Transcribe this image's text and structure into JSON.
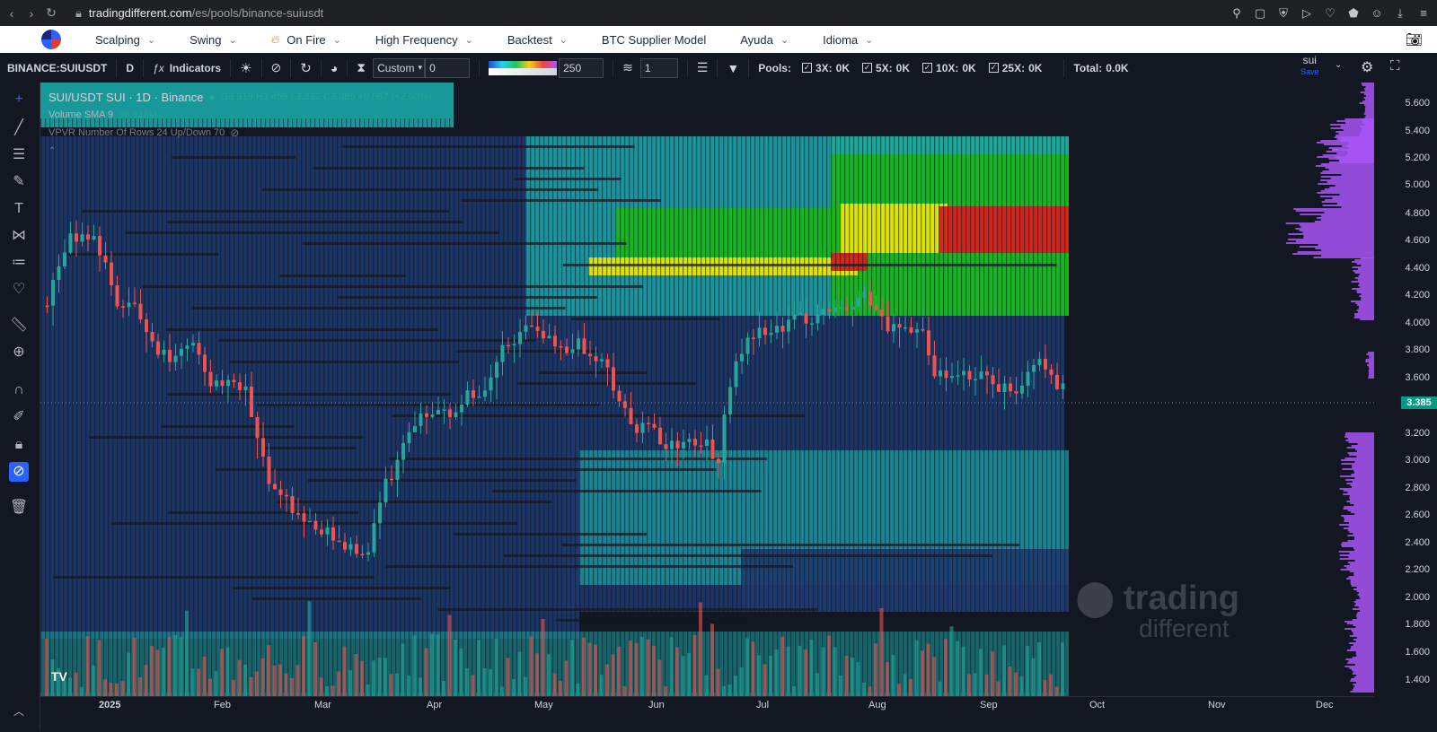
{
  "browser": {
    "url_host": "tradingdifferent.com",
    "url_path": "/es/pools/binance-suiusdt"
  },
  "menu": {
    "items": [
      "Scalping",
      "Swing",
      "On Fire",
      "High Frequency",
      "Backtest",
      "BTC Supplier Model",
      "Ayuda",
      "Idioma"
    ]
  },
  "toolbar": {
    "symbol": "BINANCE:SUIUSDT",
    "interval": "D",
    "indicators": "Indicators",
    "mode": "Custom",
    "mode_value": "0",
    "gradient_value": "250",
    "layers_value": "1",
    "pools_label": "Pools:",
    "pools": [
      {
        "label": "3X:",
        "value": "0K"
      },
      {
        "label": "5X:",
        "value": "0K"
      },
      {
        "label": "10X:",
        "value": "0K"
      },
      {
        "label": "25X:",
        "value": "0K"
      }
    ],
    "total_label": "Total:",
    "total_value": "0.0K",
    "layout_name": "sui",
    "layout_save": "Save"
  },
  "legend": {
    "title": "SUI/USDT SUI · 1D · Binance",
    "ohlc": "O3.319 H3.459 L3.232 C3.385 +0.067 (+2.00%)",
    "volume": "Volume SMA 9",
    "volume_val": "36.518M",
    "vpvr": "VPVR Number Of Rows 24 Up/Down 70"
  },
  "colors": {
    "up": "#26a69a",
    "down": "#ef5350",
    "heat_low": "#1e3a6e",
    "heat_mid": "#1aa6a6",
    "heat_green": "#16b816",
    "heat_yellow": "#e6e600",
    "heat_red": "#d61f1f",
    "profile": "#a855f7",
    "accent": "#2962ff"
  },
  "price_axis": {
    "ticks": [
      "5.600",
      "5.400",
      "5.200",
      "5.000",
      "4.800",
      "4.600",
      "4.400",
      "4.200",
      "4.000",
      "3.800",
      "3.600",
      "3.200",
      "3.000",
      "2.800",
      "2.600",
      "2.400",
      "2.200",
      "2.000",
      "1.800",
      "1.600",
      "1.400"
    ],
    "current": "3.385"
  },
  "time_axis": {
    "labels": [
      "2025",
      "Feb",
      "Mar",
      "Apr",
      "May",
      "Jun",
      "Jul",
      "Aug",
      "Sep",
      "Oct",
      "Nov",
      "Dec"
    ]
  },
  "watermark": {
    "line1": "trading",
    "line2": "different"
  },
  "tv_logo": "TV"
}
